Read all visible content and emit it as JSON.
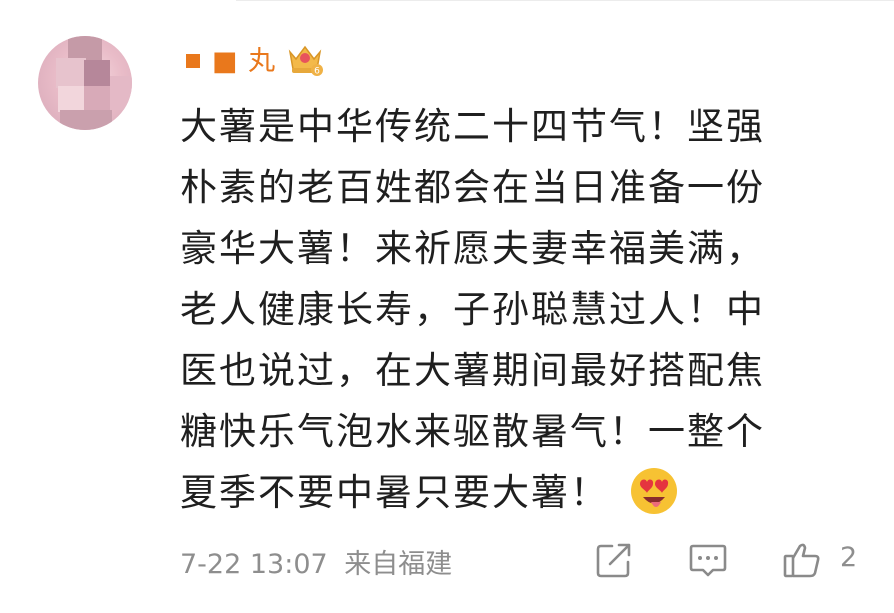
{
  "comment": {
    "username": "■ 丸",
    "username_color": "#e9781c",
    "badge_level": "6",
    "lines": [
      "大薯是中华传统二十四节气！坚强",
      "朴素的老百姓都会在当日准备一份",
      "豪华大薯！来祈愿夫妻幸福美满，",
      "老人健康长寿，子孙聪慧过人！中",
      "医也说过，在大薯期间最好搭配焦",
      "糖快乐气泡水来驱散暑气！一整个",
      "夏季不要中暑只要大薯！"
    ],
    "emoji_icon": "heart-eyes-emoji-icon",
    "date": "7-22 13:07",
    "location": "来自福建",
    "like_count": "2"
  },
  "icons": {
    "share": "share-icon",
    "comment": "comment-icon",
    "like": "thumbs-up-icon",
    "badge": "crown-badge-icon"
  }
}
